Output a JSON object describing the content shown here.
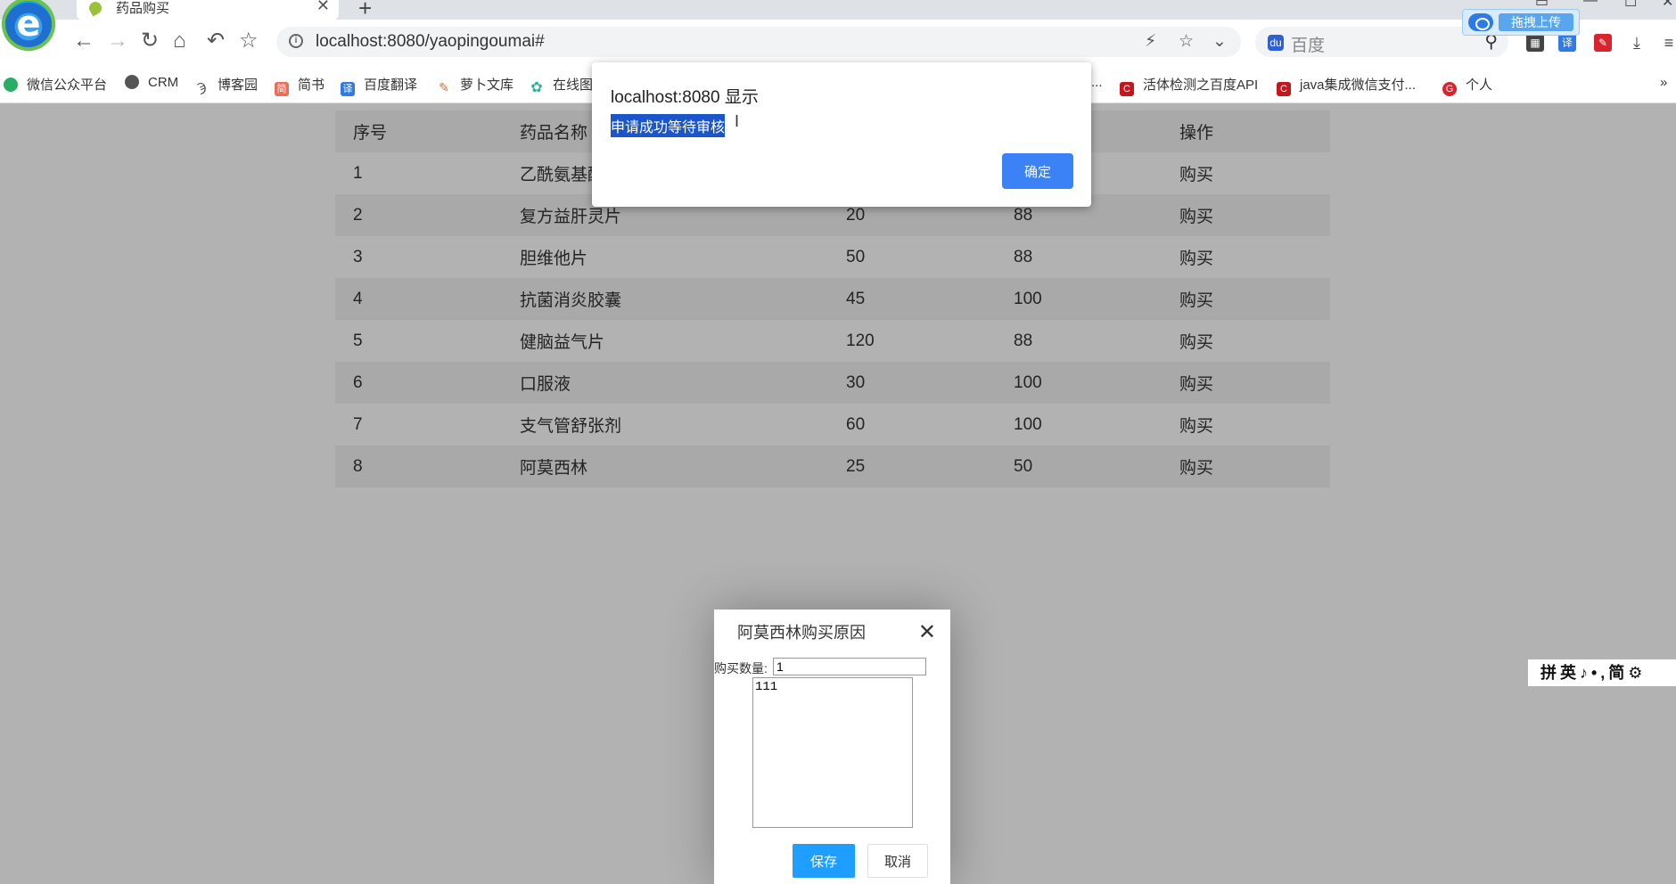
{
  "browser": {
    "tab_title": "药品购买",
    "url": "localhost:8080/yaopingoumai#",
    "search_placeholder": "百度",
    "upload_label": "拖拽上传"
  },
  "bookmarks": [
    {
      "label": "微信公众平台",
      "color": "#2aae67"
    },
    {
      "label": "CRM",
      "color": "#555555"
    },
    {
      "label": "博客园",
      "color": "#444444"
    },
    {
      "label": "简书",
      "color": "#ea6f5a"
    },
    {
      "label": "百度翻译",
      "color": "#2f7ae5"
    },
    {
      "label": "萝卜文库",
      "color": "#e36b1c"
    },
    {
      "label": "在线图",
      "color": "#2fb3a0"
    },
    {
      "label": "...",
      "color": "#ffffff"
    },
    {
      "label": "活体检测之百度API",
      "color": "#c4161c"
    },
    {
      "label": "java集成微信支付...",
      "color": "#c4161c"
    },
    {
      "label": "个人",
      "color": "#d9232d"
    }
  ],
  "bookmarks_more": "»",
  "table": {
    "headers": [
      "序号",
      "药品名称",
      "",
      "",
      "操作"
    ],
    "rows": [
      [
        "1",
        "乙酰氨基酚",
        "",
        "",
        "购买"
      ],
      [
        "2",
        "复方益肝灵片",
        "20",
        "88",
        "购买"
      ],
      [
        "3",
        "胆维他片",
        "50",
        "88",
        "购买"
      ],
      [
        "4",
        "抗菌消炎胶囊",
        "45",
        "100",
        "购买"
      ],
      [
        "5",
        "健脑益气片",
        "120",
        "88",
        "购买"
      ],
      [
        "6",
        "口服液",
        "30",
        "100",
        "购买"
      ],
      [
        "7",
        "支气管舒张剂",
        "60",
        "100",
        "购买"
      ],
      [
        "8",
        "阿莫西林",
        "25",
        "50",
        "购买"
      ]
    ]
  },
  "dialog": {
    "title": "阿莫西林购买原因",
    "qty_label": "购买数量:",
    "qty_value": "1",
    "reason_value": "111",
    "save_label": "保存",
    "cancel_label": "取消"
  },
  "alert": {
    "title": "localhost:8080 显示",
    "message": "申请成功等待审核",
    "ok_label": "确定"
  },
  "ime": {
    "text": "拼英♪•,简⚙"
  },
  "colors": {
    "primary_button": "#1e9fff",
    "alert_button": "#3b82f6",
    "selection": "#1a56c9"
  }
}
